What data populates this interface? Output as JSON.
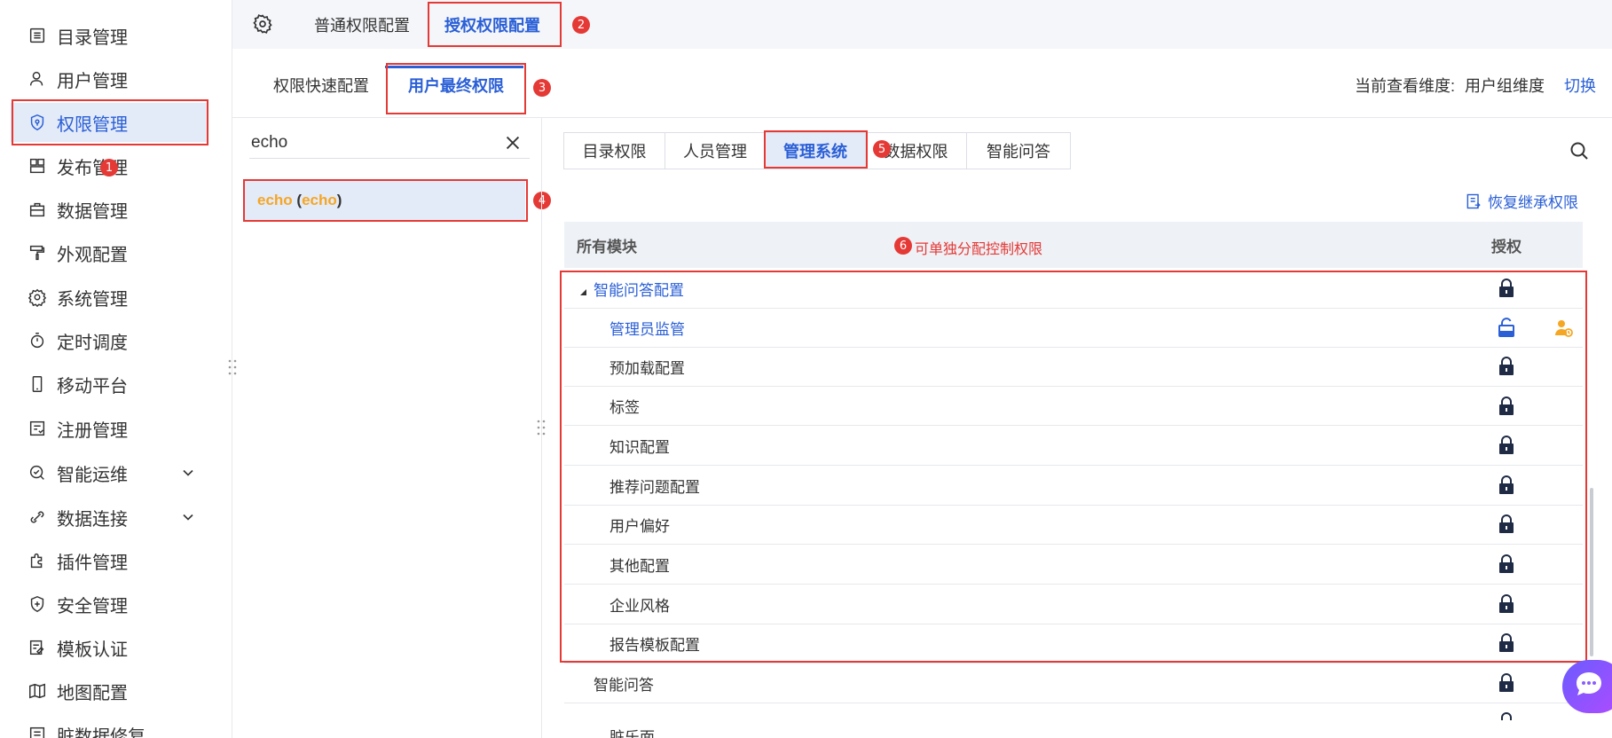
{
  "sidebar": {
    "items": [
      {
        "label": "目录管理",
        "icon": "list-icon"
      },
      {
        "label": "用户管理",
        "icon": "user-icon"
      },
      {
        "label": "权限管理",
        "icon": "shield-icon",
        "active": true
      },
      {
        "label": "发布管理",
        "icon": "layout-icon"
      },
      {
        "label": "数据管理",
        "icon": "database-icon"
      },
      {
        "label": "外观配置",
        "icon": "paint-roller-icon"
      },
      {
        "label": "系统管理",
        "icon": "gear-icon"
      },
      {
        "label": "定时调度",
        "icon": "timer-icon"
      },
      {
        "label": "移动平台",
        "icon": "mobile-icon"
      },
      {
        "label": "注册管理",
        "icon": "register-icon"
      },
      {
        "label": "智能运维",
        "icon": "ops-icon",
        "expandable": true
      },
      {
        "label": "数据连接",
        "icon": "link-icon",
        "expandable": true
      },
      {
        "label": "插件管理",
        "icon": "puzzle-icon"
      },
      {
        "label": "安全管理",
        "icon": "shield-plus-icon"
      },
      {
        "label": "模板认证",
        "icon": "cert-icon"
      },
      {
        "label": "地图配置",
        "icon": "map-icon"
      },
      {
        "label": "脏数据修复",
        "icon": "repair-icon"
      }
    ]
  },
  "top_tabs": {
    "tab1": "普通权限配置",
    "tab2": "授权权限配置"
  },
  "sub_tabs": {
    "tab1": "权限快速配置",
    "tab2": "用户最终权限"
  },
  "dimension": {
    "label": "当前查看维度:",
    "value": "用户组维度",
    "switch": "切换"
  },
  "search": {
    "value": "echo"
  },
  "user_item": {
    "name": "echo",
    "paren_open": " (",
    "id": "echo",
    "paren_close": ")"
  },
  "seg_tabs": [
    "目录权限",
    "人员管理",
    "管理系统",
    "数据权限",
    "智能问答"
  ],
  "restore": "恢复继承权限",
  "table": {
    "col_module": "所有模块",
    "col_auth": "授权",
    "note": "可单独分配控制权限",
    "group": "智能问答配置",
    "rows": [
      "管理员监管",
      "预加载配置",
      "标签",
      "知识配置",
      "推荐问题配置",
      "用户偏好",
      "其他配置",
      "企业风格",
      "报告模板配置"
    ],
    "after": "智能问答",
    "cut": "脏乐面"
  },
  "badges": [
    "1",
    "2",
    "3",
    "4",
    "5",
    "6"
  ],
  "colors": {
    "accent": "#2a5fd6",
    "red": "#e53935",
    "orange": "#f5a623",
    "active_bg": "#e3eaf8"
  }
}
